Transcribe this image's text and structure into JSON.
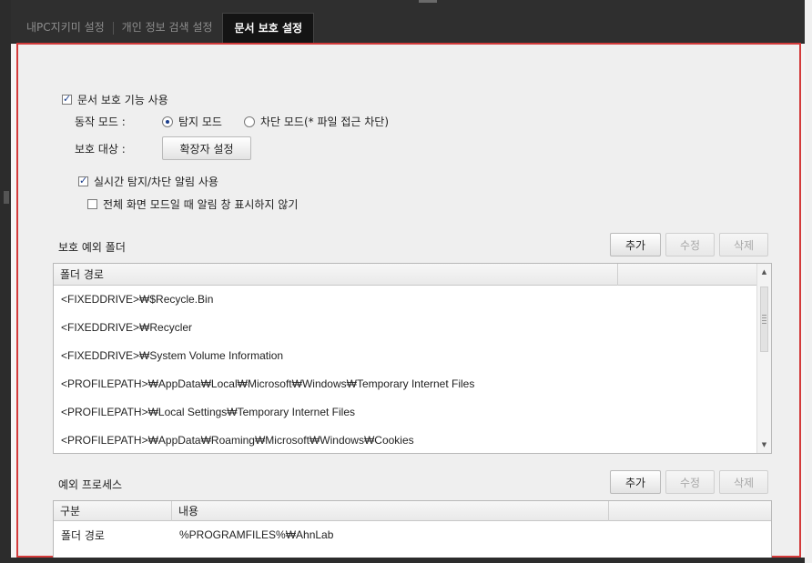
{
  "tabs": [
    {
      "label": "내PC지키미 설정"
    },
    {
      "label": "개인 정보 검색 설정"
    },
    {
      "label": "문서 보호 설정",
      "active": true
    }
  ],
  "protection": {
    "enable_label": "문서 보호 기능 사용",
    "enable_checked": true,
    "mode_label": "동작 모드 :",
    "mode_options": [
      {
        "label": "탐지 모드",
        "selected": true
      },
      {
        "label": "차단 모드(* 파일 접근 차단)",
        "selected": false
      }
    ],
    "target_label": "보호 대상 :",
    "extension_button": "확장자 설정",
    "realtime_alert_label": "실시간 탐지/차단 알림 사용",
    "realtime_alert_checked": true,
    "fullscreen_label": "전체 화면 모드일 때 알림 창 표시하지 않기",
    "fullscreen_checked": false
  },
  "excluded_folders": {
    "title": "보호 예외 폴더",
    "buttons": {
      "add": "추가",
      "edit": "수정",
      "delete": "삭제"
    },
    "column": "폴더 경로",
    "rows": [
      "<FIXEDDRIVE>₩$Recycle.Bin",
      "<FIXEDDRIVE>₩Recycler",
      "<FIXEDDRIVE>₩System Volume Information",
      "<PROFILEPATH>₩AppData₩Local₩Microsoft₩Windows₩Temporary Internet Files",
      "<PROFILEPATH>₩Local Settings₩Temporary Internet Files",
      "<PROFILEPATH>₩AppData₩Roaming₩Microsoft₩Windows₩Cookies"
    ]
  },
  "excluded_processes": {
    "title": "예외 프로세스",
    "buttons": {
      "add": "추가",
      "edit": "수정",
      "delete": "삭제"
    },
    "columns": [
      "구분",
      "내용"
    ],
    "rows": [
      {
        "type": "폴더 경로",
        "value": "%PROGRAMFILES%₩AhnLab"
      }
    ]
  },
  "colors": {
    "accent_border": "#d33a3a",
    "check_color": "#1a3d8c"
  }
}
